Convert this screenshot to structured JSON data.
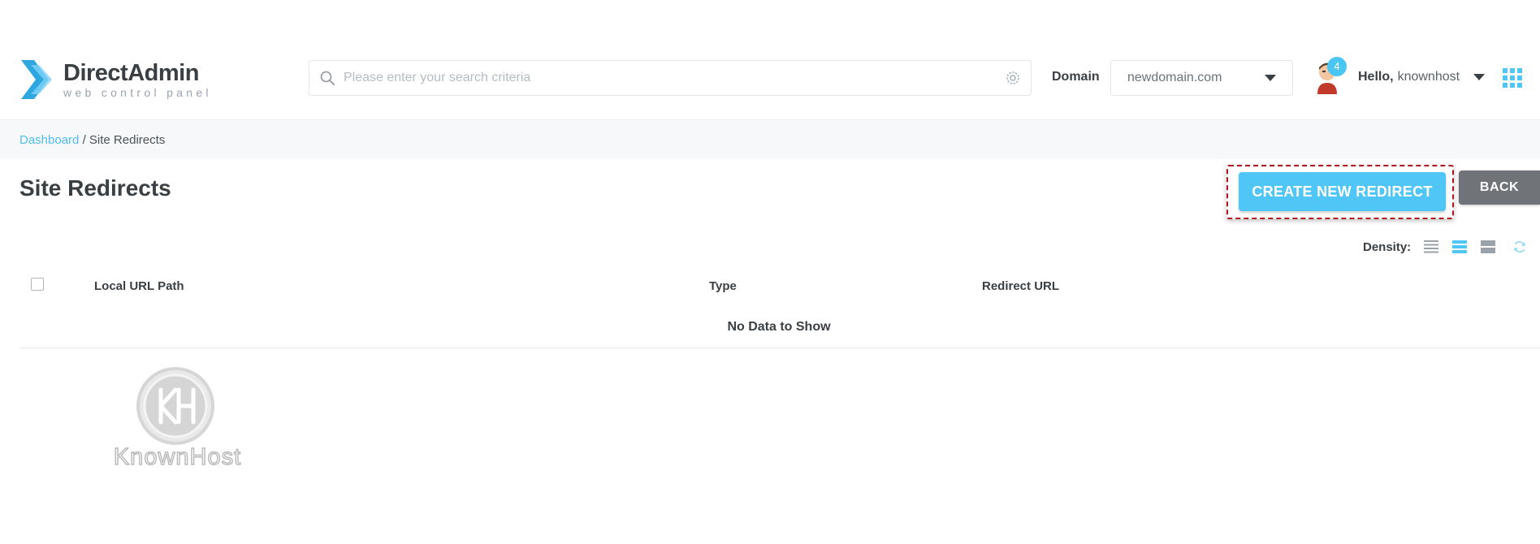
{
  "brand": {
    "title": "DirectAdmin",
    "subtitle": "web control panel",
    "colors": {
      "primary": "#2ea6e0",
      "light": "#4fc6f5"
    }
  },
  "search": {
    "placeholder": "Please enter your search criteria",
    "icon": "search-icon",
    "settings_icon": "gear-icon"
  },
  "domain": {
    "label": "Domain",
    "value": "newdomain.com"
  },
  "user": {
    "badge": "4",
    "hello": "Hello,",
    "name": "knownhost",
    "avatar_icon": "avatar-icon",
    "menu_icon": "apps-grid-icon"
  },
  "breadcrumb": {
    "root": "Dashboard",
    "separator": "/",
    "current": "Site Redirects"
  },
  "page": {
    "title": "Site Redirects",
    "create_label": "CREATE NEW REDIRECT",
    "back_label": "BACK",
    "create_highlight_color": "#b0131f"
  },
  "density": {
    "label": "Density:",
    "options": [
      "compact",
      "normal",
      "comfortable"
    ],
    "selected": "normal",
    "refresh_icon": "refresh-icon"
  },
  "table": {
    "columns": [
      "Local URL Path",
      "Type",
      "Redirect URL"
    ],
    "empty_text": "No Data to Show"
  },
  "watermark": {
    "text": "KnownHost",
    "monogram": "KH"
  }
}
